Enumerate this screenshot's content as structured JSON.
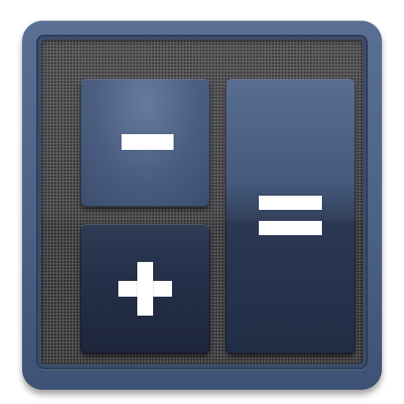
{
  "icon": {
    "kind": "calculator-app-icon",
    "keys": [
      {
        "id": "minus",
        "symbol": "minus-icon"
      },
      {
        "id": "plus",
        "symbol": "plus-icon"
      },
      {
        "id": "equals",
        "symbol": "equals-icon"
      }
    ],
    "colors": {
      "frame": "#4c6186",
      "mesh": "#4a4a4c",
      "key_light": "#40557a",
      "key_dark": "#25304a",
      "glyph": "#ffffff"
    }
  }
}
